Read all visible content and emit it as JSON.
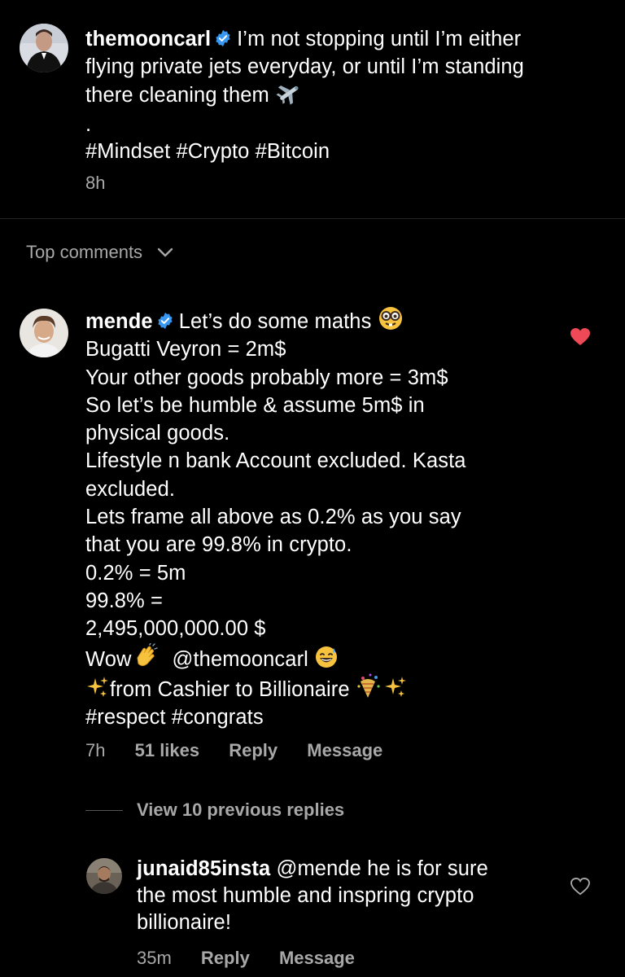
{
  "post": {
    "username": "themooncarl",
    "caption_lines": [
      "I’m not stopping until I’m either",
      "flying private jets everyday, or until I’m standing",
      "there cleaning them"
    ],
    "dot": ".",
    "hashtags": "#Mindset #Crypto #Bitcoin",
    "time": "8h"
  },
  "top_comments": {
    "label": "Top comments"
  },
  "comment": {
    "username": "mende",
    "first_line": "Let’s do some maths",
    "lines": [
      "Bugatti Veyron = 2m$",
      "Your other goods probably more = 3m$",
      "So let’s be humble & assume 5m$ in",
      "physical goods.",
      "Lifestyle n bank Account excluded. Kasta",
      "excluded.",
      "Lets frame all above as 0.2% as you say",
      "that you are 99.8% in crypto.",
      "0.2% = 5m",
      "99.8% =",
      "2,495,000,000.00 $"
    ],
    "wow": "Wow",
    "mention": "@themooncarl",
    "billionaire": "from Cashier to Billionaire",
    "tags": "#respect #congrats",
    "time": "7h",
    "likes": "51 likes",
    "reply": "Reply",
    "message": "Message",
    "heart_color": "#ed4956"
  },
  "view_replies": "View 10 previous replies",
  "reply": {
    "username": "junaid85insta",
    "mention": "@mende",
    "text_first": "he is for sure",
    "text_lines": [
      "the most humble and inspring crypto",
      "billionaire!"
    ],
    "time": "35m",
    "reply": "Reply",
    "message": "Message"
  }
}
